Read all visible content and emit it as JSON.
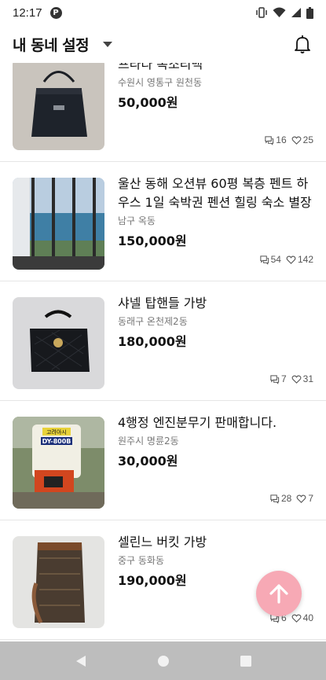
{
  "status": {
    "time": "12:17",
    "notification_icon": "p-badge-icon",
    "icons": [
      "vibrate-icon",
      "wifi-icon",
      "signal-icon",
      "battery-icon"
    ]
  },
  "header": {
    "title": "내 동네 설정",
    "dropdown_icon": "caret-down-icon",
    "bell_icon": "bell-icon"
  },
  "listings": [
    {
      "title": "프라다 복조리백",
      "location": "수원시 영통구 원천동",
      "price": "50,000원",
      "chats": "16",
      "likes": "25"
    },
    {
      "title": "울산 동해 오션뷰 60평 복층 펜트 하우스 1일 숙박권 펜션 힐링 숙소 별장",
      "location": "남구 옥동",
      "price": "150,000원",
      "chats": "54",
      "likes": "142"
    },
    {
      "title": "샤넬 탑핸들 가방",
      "location": "동래구 온천제2동",
      "price": "180,000원",
      "chats": "7",
      "likes": "31"
    },
    {
      "title": "4행정 엔진분무기 판매합니다.",
      "location": "원주시 명륜2동",
      "price": "30,000원",
      "chats": "28",
      "likes": "7"
    },
    {
      "title": "셀린느 버킷 가방",
      "location": "중구 동화동",
      "price": "190,000원",
      "chats": "6",
      "likes": "40"
    }
  ],
  "product_label": {
    "brand_text": "고려아시",
    "model_text": "DY-800B"
  },
  "fab": {
    "icon": "arrow-up-icon",
    "color": "#f7a9b5"
  },
  "nav": {
    "icons": [
      "back-triangle-icon",
      "home-circle-icon",
      "recents-square-icon"
    ]
  },
  "colors": {
    "accent_fab": "#f7a9b5",
    "navbar": "#bdbdbd",
    "divider": "#e6e6e6"
  }
}
